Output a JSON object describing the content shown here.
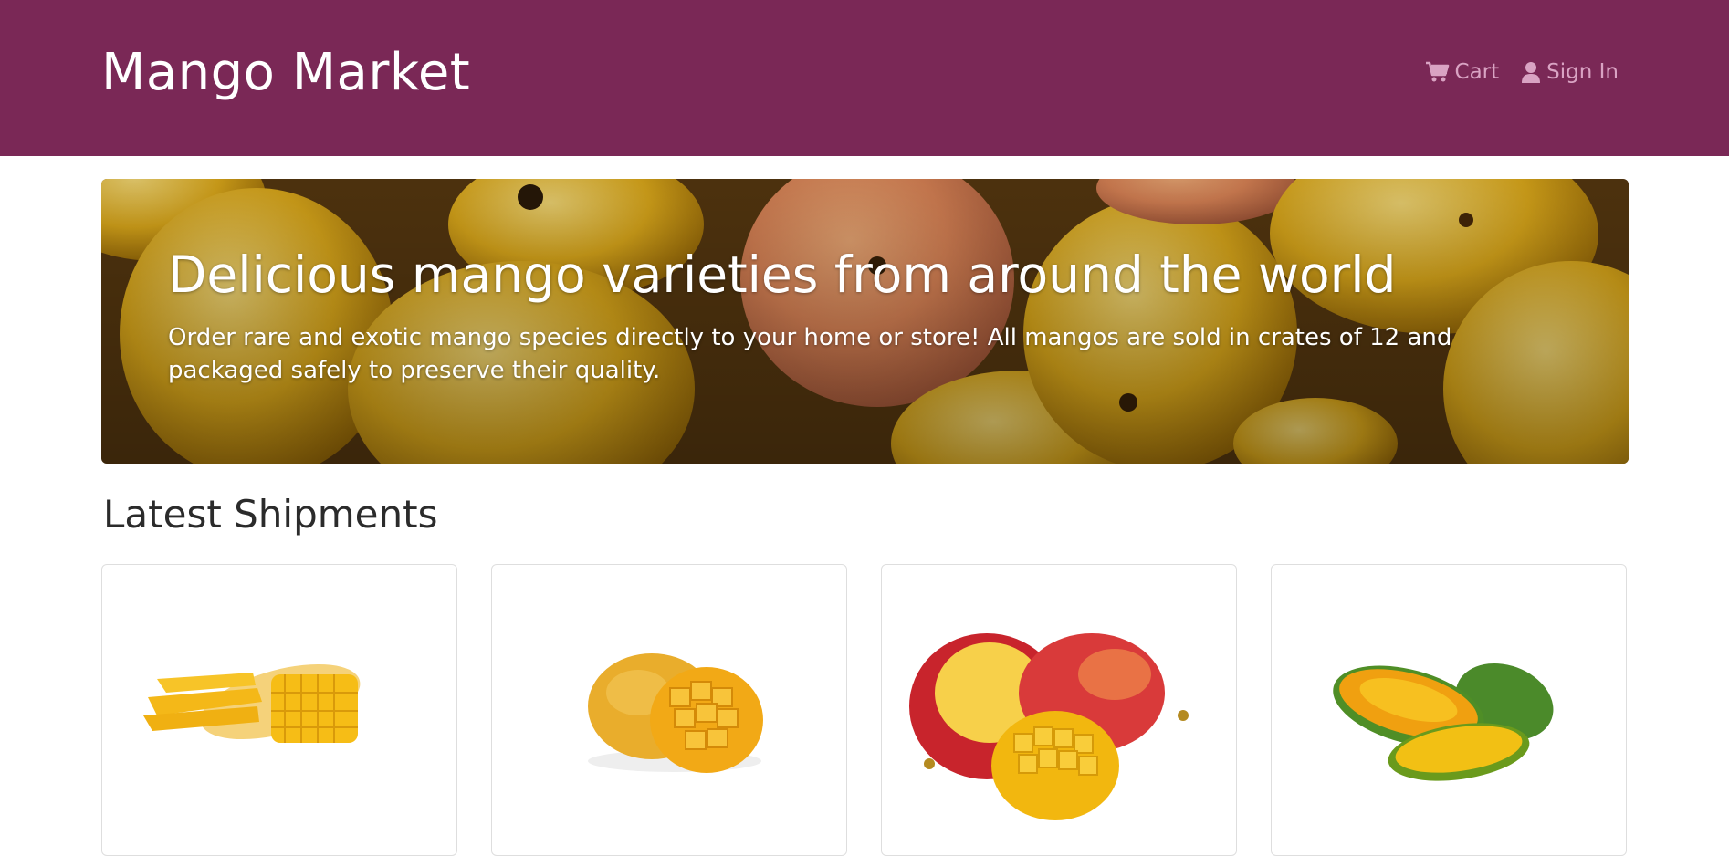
{
  "header": {
    "brand": "Mango Market",
    "nav": {
      "cart_label": "Cart",
      "signin_label": "Sign In",
      "cart_icon": "cart-icon",
      "signin_icon": "user-icon"
    }
  },
  "hero": {
    "title": "Delicious mango varieties from around the world",
    "text": "Order rare and exotic mango species directly to your home or store! All mangos are sold in crates of 12 and packaged safely to preserve their quality."
  },
  "latest": {
    "title": "Latest Shipments",
    "cards": [
      {
        "image": "mango-product-image-1"
      },
      {
        "image": "mango-product-image-2"
      },
      {
        "image": "mango-product-image-3"
      },
      {
        "image": "mango-product-image-4"
      }
    ]
  },
  "colors": {
    "navbar": "#7a2856",
    "nav_link": "#d9a3c3",
    "heading": "#2b2b2b"
  }
}
